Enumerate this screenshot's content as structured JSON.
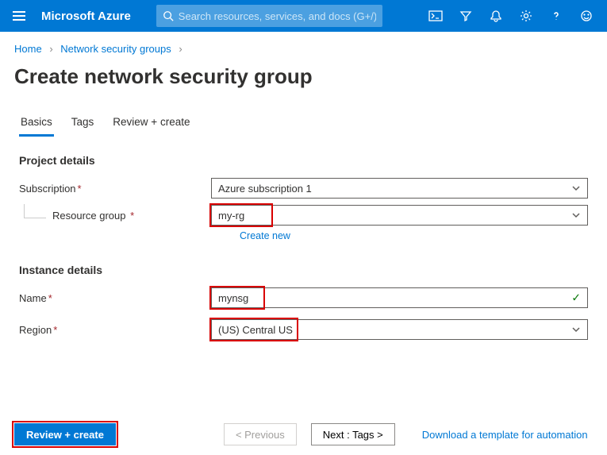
{
  "header": {
    "brand": "Microsoft Azure",
    "search_placeholder": "Search resources, services, and docs (G+/)"
  },
  "breadcrumb": {
    "home": "Home",
    "current": "Network security groups"
  },
  "page_title": "Create network security group",
  "tabs": {
    "basics": "Basics",
    "tags": "Tags",
    "review": "Review + create"
  },
  "sections": {
    "project": "Project details",
    "instance": "Instance details"
  },
  "fields": {
    "subscription_label": "Subscription",
    "subscription_value": "Azure subscription 1",
    "resource_group_label": "Resource group",
    "resource_group_value": "my-rg",
    "create_new": "Create new",
    "name_label": "Name",
    "name_value": "mynsg",
    "region_label": "Region",
    "region_value": "(US) Central US"
  },
  "footer": {
    "review_create": "Review + create",
    "previous": "< Previous",
    "next": "Next : Tags >",
    "download": "Download a template for automation"
  }
}
